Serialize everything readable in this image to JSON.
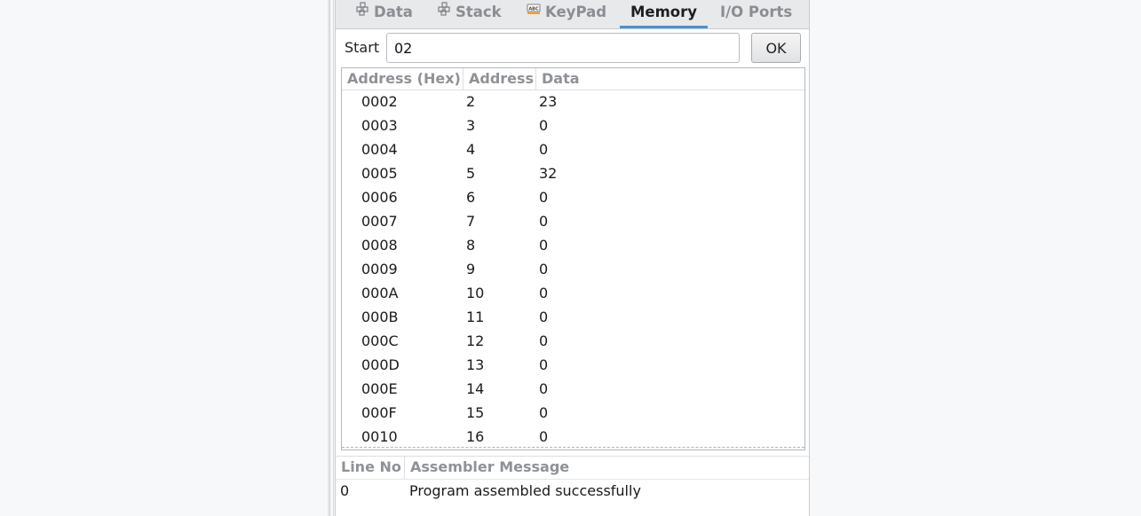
{
  "tabs": [
    {
      "label": "Data",
      "icon": "cluster-icon",
      "active": false
    },
    {
      "label": "Stack",
      "icon": "cluster-icon",
      "active": false
    },
    {
      "label": "KeyPad",
      "icon": "keypad-icon",
      "active": false
    },
    {
      "label": "Memory",
      "active": true
    },
    {
      "label": "I/O Ports",
      "active": false
    }
  ],
  "start": {
    "label": "Start",
    "value": "02",
    "ok_label": "OK"
  },
  "memory_table": {
    "headers": [
      "Address (Hex)",
      "Address",
      "Data"
    ],
    "rows": [
      [
        "0002",
        "2",
        "23"
      ],
      [
        "0003",
        "3",
        "0"
      ],
      [
        "0004",
        "4",
        "0"
      ],
      [
        "0005",
        "5",
        "32"
      ],
      [
        "0006",
        "6",
        "0"
      ],
      [
        "0007",
        "7",
        "0"
      ],
      [
        "0008",
        "8",
        "0"
      ],
      [
        "0009",
        "9",
        "0"
      ],
      [
        "000A",
        "10",
        "0"
      ],
      [
        "000B",
        "11",
        "0"
      ],
      [
        "000C",
        "12",
        "0"
      ],
      [
        "000D",
        "13",
        "0"
      ],
      [
        "000E",
        "14",
        "0"
      ],
      [
        "000F",
        "15",
        "0"
      ],
      [
        "0010",
        "16",
        "0"
      ]
    ]
  },
  "messages": {
    "headers": [
      "Line No",
      "Assembler Message"
    ],
    "rows": [
      [
        "0",
        "Program assembled successfully"
      ]
    ]
  },
  "colors": {
    "accent": "#4b8fd8",
    "header_text": "#8e9196"
  }
}
